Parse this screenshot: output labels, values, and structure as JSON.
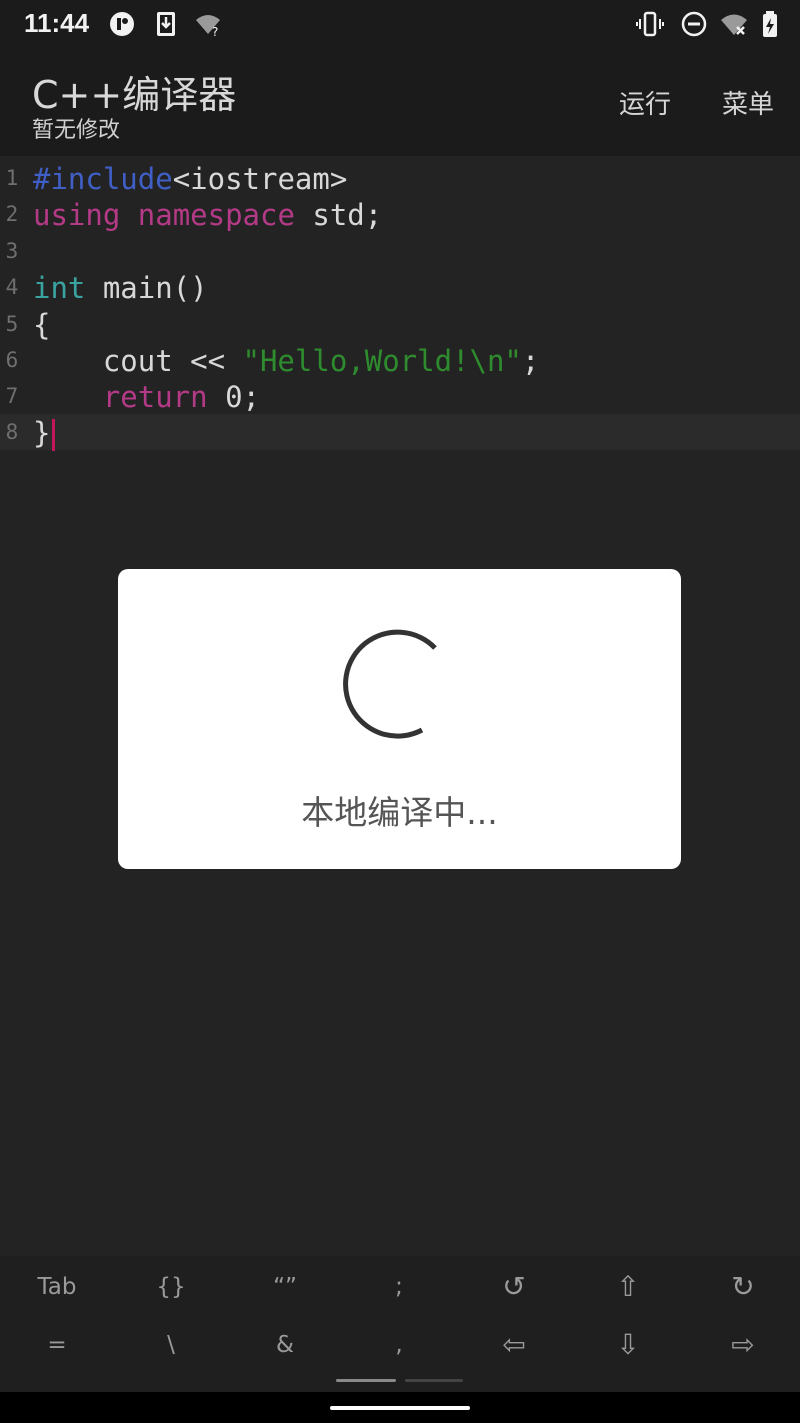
{
  "status_bar": {
    "time": "11:44",
    "left_icons": [
      "assistant-icon",
      "download-icon",
      "wifi-question-icon"
    ],
    "right_icons": [
      "vibrate-icon",
      "do-not-disturb-icon",
      "wifi-off-icon",
      "battery-icon"
    ]
  },
  "app_bar": {
    "title": "C++编译器",
    "subtitle": "暂无修改",
    "run_label": "运行",
    "menu_label": "菜单"
  },
  "editor": {
    "line_numbers": [
      "1",
      "2",
      "3",
      "4",
      "5",
      "6",
      "7",
      "8"
    ],
    "current_line": 8
  },
  "dialog": {
    "message": "本地编译中..."
  },
  "extra_keys": {
    "row1": [
      "Tab",
      "{}",
      "“”",
      ";",
      "↺",
      "⇧",
      "↻"
    ],
    "row2": [
      "=",
      "\\",
      "&",
      ",",
      "⇦",
      "⇩",
      "⇨"
    ]
  },
  "colors": {
    "background": "#232323",
    "bar": "#1b1b1b",
    "keyword_include": "#3f5fc6",
    "keyword_pink": "#b33a86",
    "keyword_type": "#3aa3a0",
    "string": "#2e8c2e",
    "cursor": "#c2185b"
  }
}
